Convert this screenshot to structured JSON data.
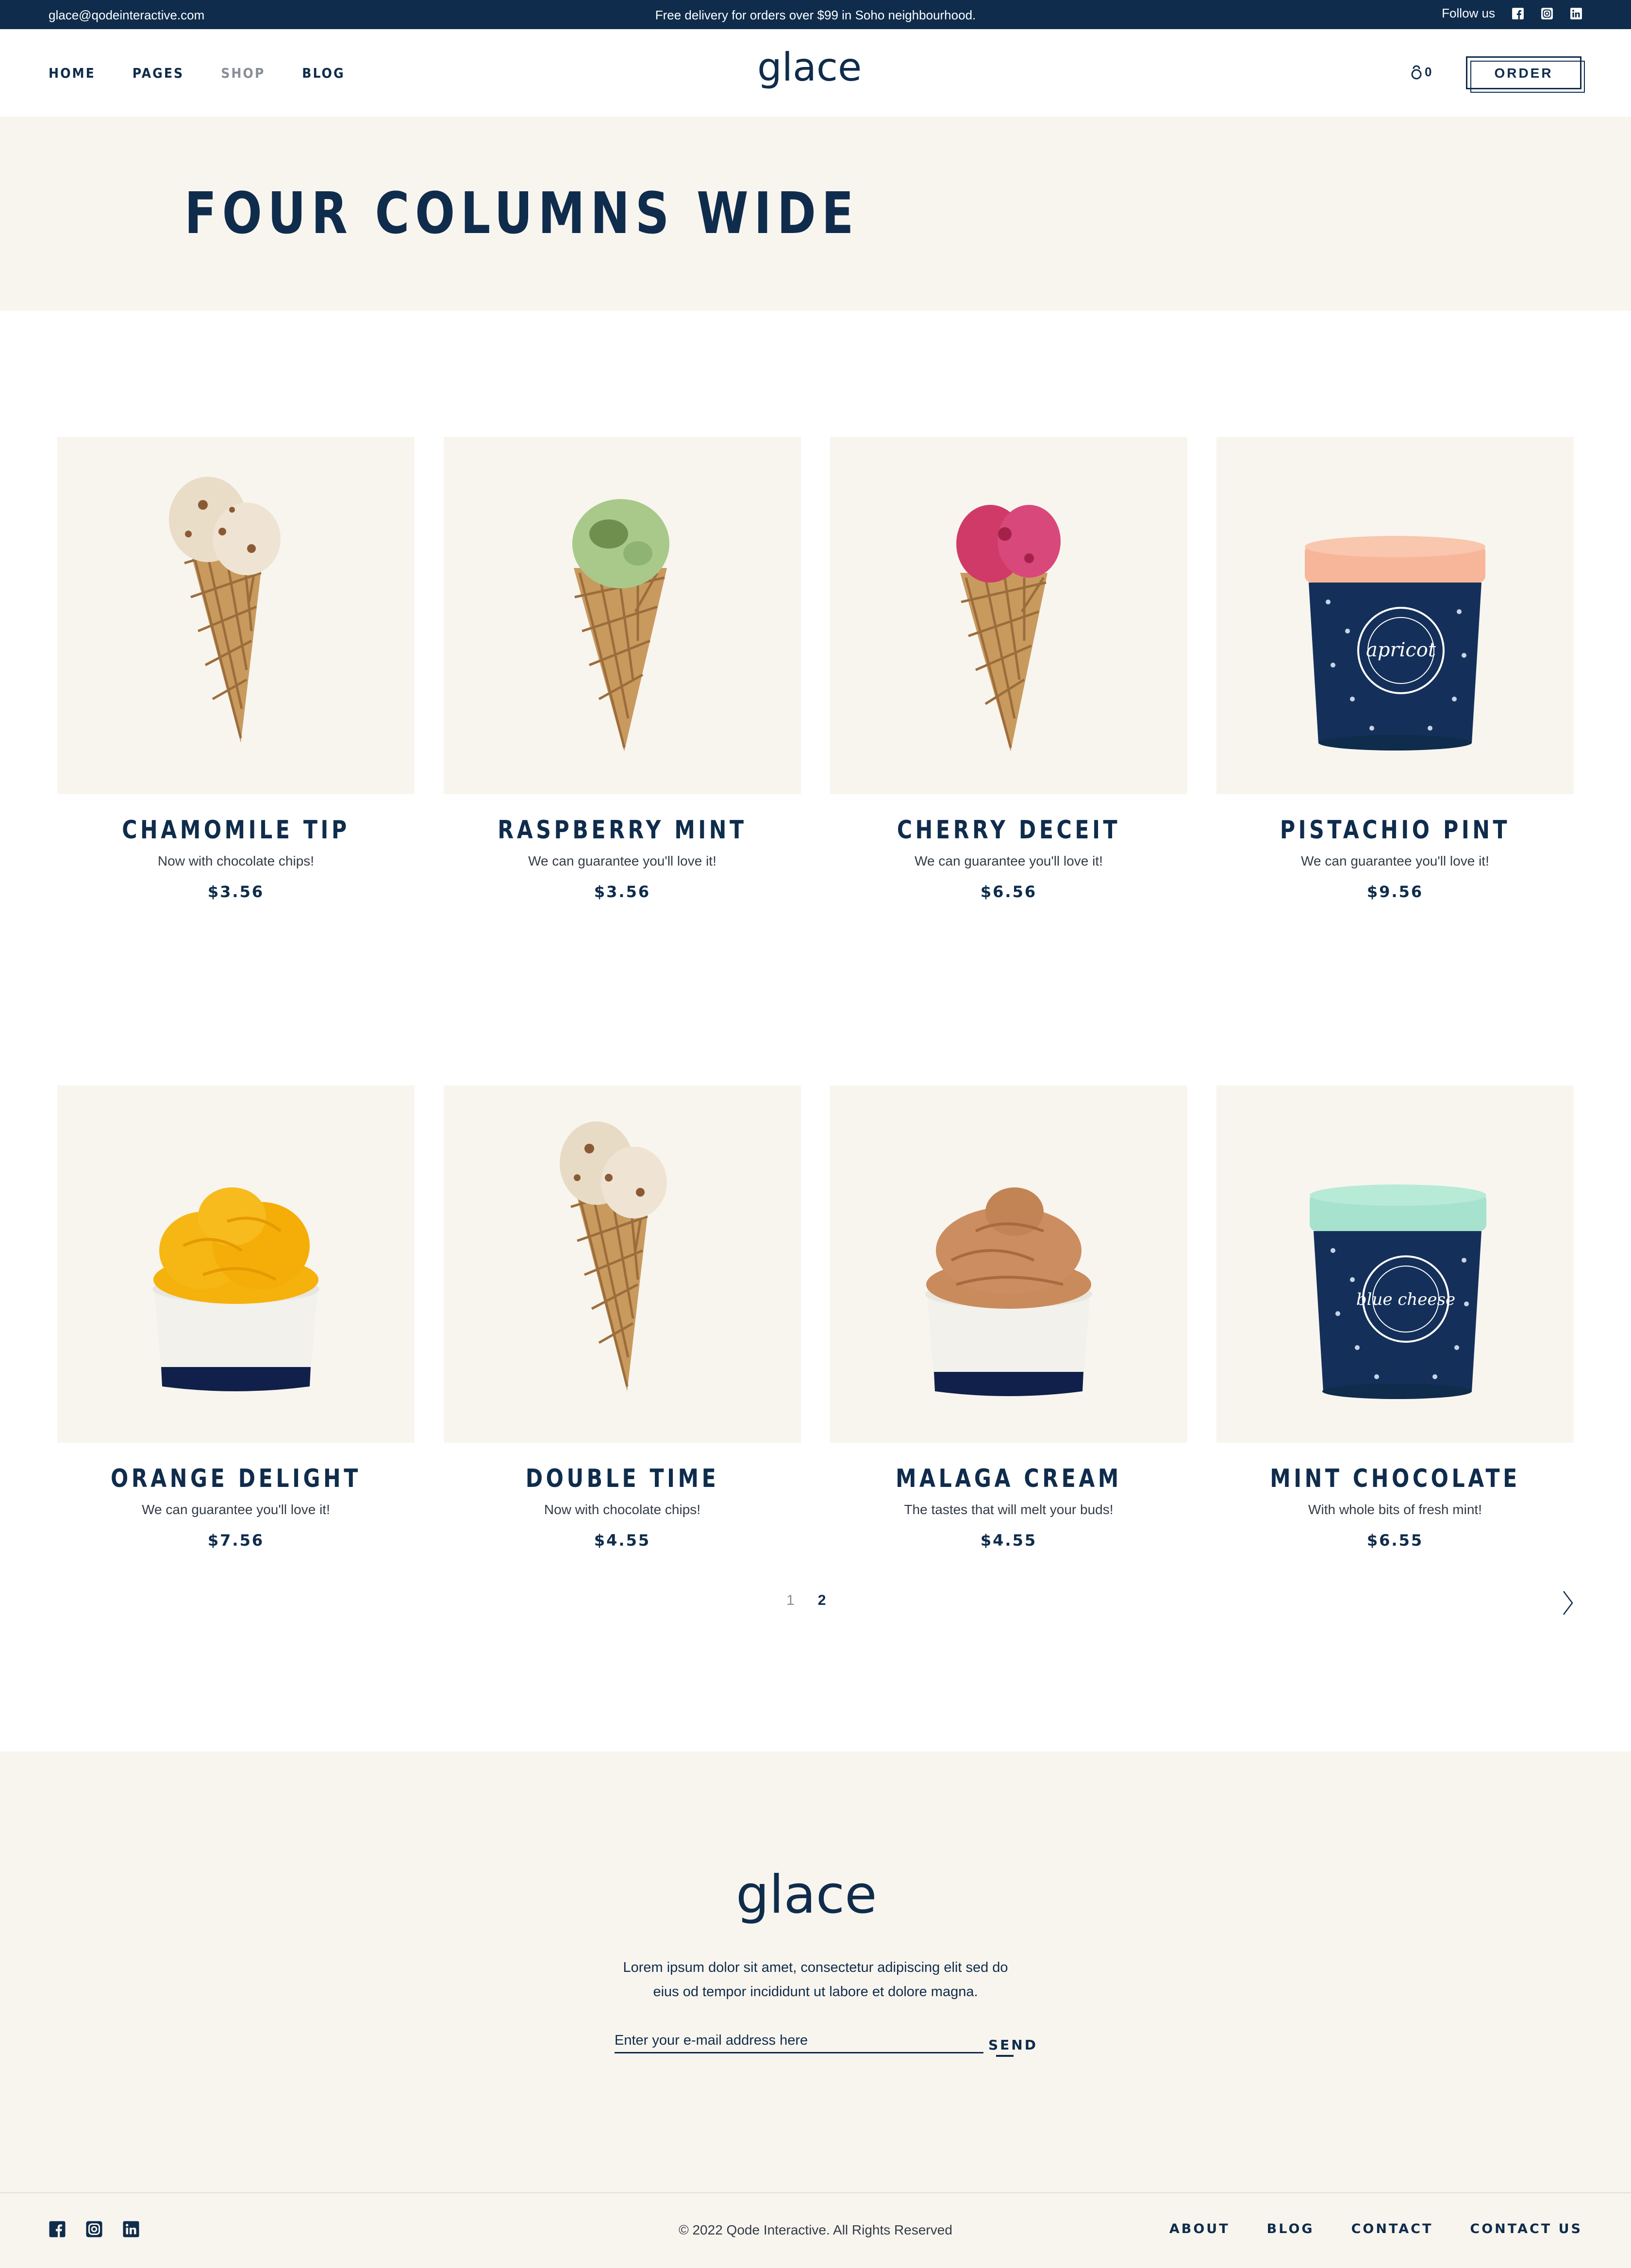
{
  "topbar": {
    "email": "glace@qodeinteractive.com",
    "promo": "Free delivery for orders over $99 in Soho neighbourhood.",
    "follow_label": "Follow us"
  },
  "header": {
    "logo_text": "glace",
    "nav": [
      {
        "label": "HOME"
      },
      {
        "label": "PAGES"
      },
      {
        "label": "SHOP"
      },
      {
        "label": "BLOG"
      }
    ],
    "cart_count": "0",
    "order_label": "ORDER"
  },
  "page": {
    "title": "FOUR COLUMNS WIDE"
  },
  "products": [
    {
      "name": "CHAMOMILE TIP",
      "desc": "Now with chocolate chips!",
      "price": "$3.56"
    },
    {
      "name": "RASPBERRY MINT",
      "desc": "We can guarantee you'll love it!",
      "price": "$3.56"
    },
    {
      "name": "CHERRY DECEIT",
      "desc": "We can guarantee you'll love it!",
      "price": "$6.56"
    },
    {
      "name": "PISTACHIO PINT",
      "desc": "We can guarantee you'll love it!",
      "price": "$9.56"
    },
    {
      "name": "ORANGE DELIGHT",
      "desc": "We can guarantee you'll love it!",
      "price": "$7.56"
    },
    {
      "name": "DOUBLE TIME",
      "desc": "Now with chocolate chips!",
      "price": "$4.55"
    },
    {
      "name": "MALAGA CREAM",
      "desc": "The tastes that will melt your buds!",
      "price": "$4.55"
    },
    {
      "name": "MINT CHOCOLATE",
      "desc": "With whole bits of fresh mint!",
      "price": "$6.55"
    }
  ],
  "pagination": {
    "pages": [
      "1",
      "2"
    ]
  },
  "footer": {
    "logo_text": "glace",
    "text_line1": "Lorem ipsum dolor sit amet, consectetur adipiscing elit sed do",
    "text_line2": "eius od tempor incididunt ut labore et dolore magna.",
    "email_placeholder": "Enter your e-mail address here",
    "send_label": "SEND",
    "copyright": "© 2022 Qode Interactive. All Rights Reserved",
    "nav": [
      {
        "label": "ABOUT"
      },
      {
        "label": "BLOG"
      },
      {
        "label": "CONTACT"
      },
      {
        "label": "CONTACT US"
      }
    ]
  },
  "images": [
    {
      "icon": "cone-icon",
      "scoop": "#e9ddc8",
      "accent": "#8a5a34"
    },
    {
      "icon": "cone-icon",
      "scoop": "#a8c98a",
      "accent": "#6f8f4e"
    },
    {
      "icon": "cone-icon",
      "scoop": "#cf3a68",
      "accent": "#a4214a"
    },
    {
      "icon": "pint-icon",
      "lid": "#f7b69a",
      "label": "apricot"
    },
    {
      "icon": "cup-icon",
      "scoop": "#f5b10c",
      "accent": "#e59a00"
    },
    {
      "icon": "cone-icon",
      "scoop": "#e8dbc6",
      "accent": "#8a5a34"
    },
    {
      "icon": "cup-icon",
      "scoop": "#c98b5c",
      "accent": "#a86b40"
    },
    {
      "icon": "pint-icon",
      "lid": "#a6e2cd",
      "label": "blue cheese"
    }
  ],
  "colors": {
    "navy": "#0f2c4c",
    "cream": "#f8f5ef",
    "muted": "#8a8f96"
  }
}
